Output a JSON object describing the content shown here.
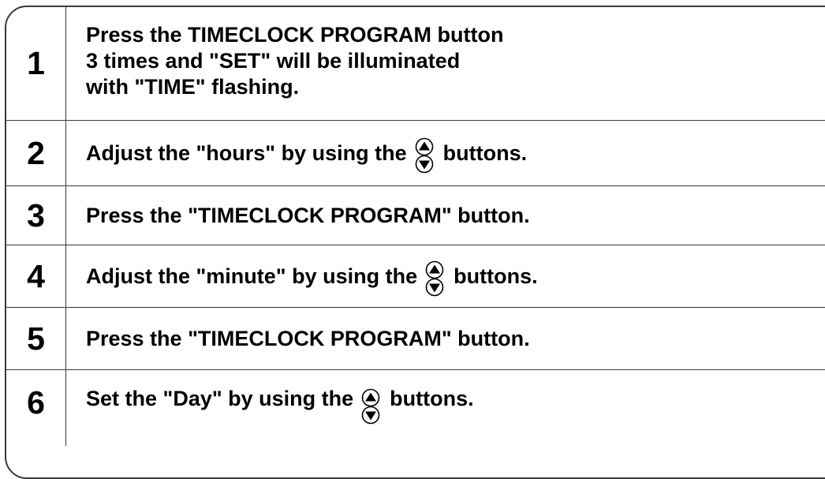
{
  "steps": [
    {
      "number": "1",
      "lines": [
        "Press the TIMECLOCK PROGRAM button",
        "3 times and \"SET\" will be illuminated",
        "with \"TIME\" flashing."
      ]
    },
    {
      "number": "2",
      "before": "Adjust the \"hours\" by using the",
      "after": "buttons.",
      "icon": "up-down-arrow-buttons"
    },
    {
      "number": "3",
      "text": "Press the \"TIMECLOCK PROGRAM\" button."
    },
    {
      "number": "4",
      "before": "Adjust the \"minute\" by using the",
      "after": "buttons.",
      "icon": "up-down-arrow-buttons"
    },
    {
      "number": "5",
      "text": "Press the \"TIMECLOCK PROGRAM\" button."
    },
    {
      "number": "6",
      "before": "Set the \"Day\" by using the",
      "after": "buttons.",
      "icon": "up-down-arrow-buttons"
    }
  ],
  "colors": {
    "border": "#3a3a3a",
    "text": "#000000",
    "background": "#ffffff"
  }
}
